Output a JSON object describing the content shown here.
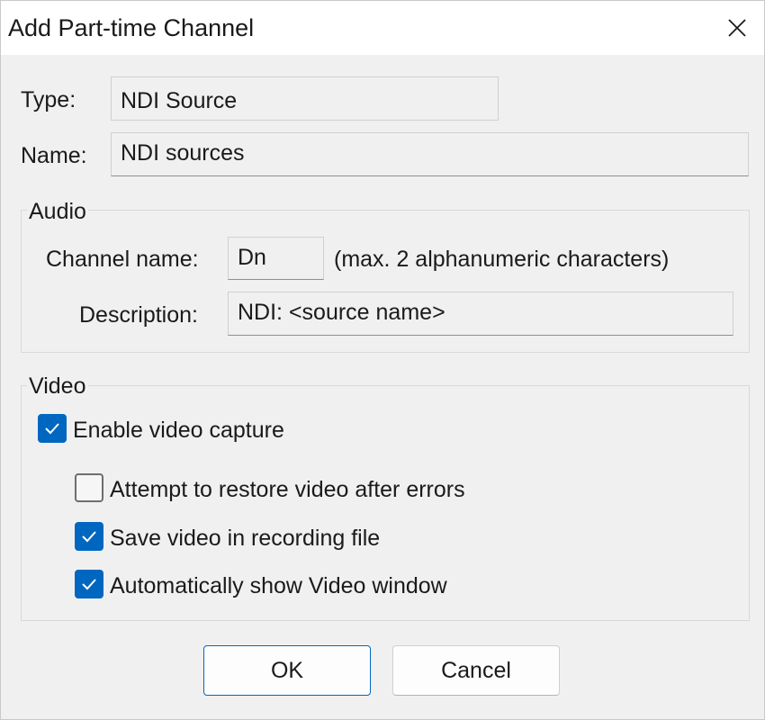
{
  "window": {
    "title": "Add Part-time Channel",
    "close_icon": "close-icon"
  },
  "form": {
    "type_label": "Type:",
    "type_value": "NDI Source",
    "name_label": "Name:",
    "name_value": "NDI sources"
  },
  "audio": {
    "group_title": "Audio",
    "channel_name_label": "Channel name:",
    "channel_name_value": "Dn",
    "channel_name_hint": "(max. 2 alphanumeric characters)",
    "description_label": "Description:",
    "description_value": "NDI: <source name>"
  },
  "video": {
    "group_title": "Video",
    "checkboxes": [
      {
        "label": "Enable video capture",
        "checked": true
      },
      {
        "label": "Attempt to restore video after errors",
        "checked": false
      },
      {
        "label": "Save video in recording file",
        "checked": true
      },
      {
        "label": "Automatically show Video window",
        "checked": true
      }
    ]
  },
  "buttons": {
    "ok_label": "OK",
    "cancel_label": "Cancel"
  },
  "colors": {
    "accent": "#0067c0",
    "background": "#f0f0f0",
    "titlebar": "#ffffff"
  }
}
